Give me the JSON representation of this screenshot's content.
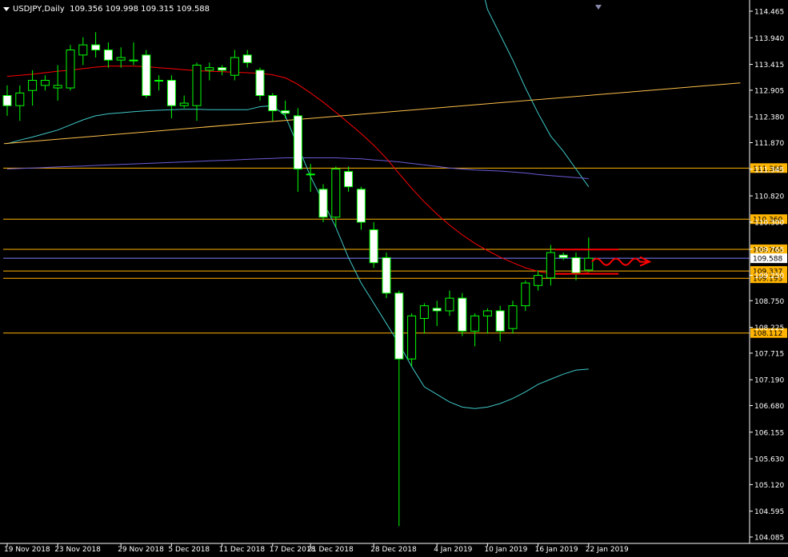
{
  "header": {
    "symbol": "USDJPY,Daily",
    "ohlc": "109.356 109.998 109.315 109.588"
  },
  "colors": {
    "background": "#000000",
    "up_candle": "#000000",
    "down_candle": "#ffffff",
    "wick": "#00ff00",
    "axis": "#ffffff",
    "hline": "#ffb400",
    "ma_red": "#ff0000",
    "ma_purple": "#6b5bd6",
    "bollinger": "#40c8c8",
    "trendline": "#ffc04a",
    "price_line": "#7f7fff",
    "annotation": "#ff0000"
  },
  "chart_data": {
    "type": "candlestick",
    "ylim": [
      104.085,
      114.465
    ],
    "y_ticks": [
      "114.465",
      "113.940",
      "113.415",
      "112.905",
      "112.380",
      "111.870",
      "111.345",
      "110.820",
      "110.300",
      "109.765",
      "109.250",
      "108.750",
      "108.225",
      "107.715",
      "107.190",
      "106.680",
      "106.155",
      "105.630",
      "105.120",
      "104.595",
      "104.085"
    ],
    "x_labels": [
      "19 Nov 2018",
      "23 Nov 2018",
      "29 Nov 2018",
      "5 Dec 2018",
      "11 Dec 2018",
      "17 Dec 2018",
      "21 Dec 2018",
      "28 Dec 2018",
      "4 Jan 2019",
      "10 Jan 2019",
      "16 Jan 2019",
      "22 Jan 2019"
    ],
    "x_label_index": [
      0,
      4,
      9,
      13,
      17,
      21,
      24,
      29,
      34,
      38,
      42,
      46
    ],
    "candles": [
      {
        "o": 112.8,
        "h": 113.0,
        "l": 112.4,
        "c": 112.6
      },
      {
        "o": 112.6,
        "h": 113.0,
        "l": 112.3,
        "c": 112.85
      },
      {
        "o": 112.9,
        "h": 113.3,
        "l": 112.6,
        "c": 113.1
      },
      {
        "o": 113.0,
        "h": 113.2,
        "l": 112.9,
        "c": 113.1
      },
      {
        "o": 112.95,
        "h": 113.4,
        "l": 112.7,
        "c": 113.0
      },
      {
        "o": 112.95,
        "h": 113.8,
        "l": 112.9,
        "c": 113.7
      },
      {
        "o": 113.6,
        "h": 113.95,
        "l": 113.4,
        "c": 113.8
      },
      {
        "o": 113.8,
        "h": 114.05,
        "l": 113.55,
        "c": 113.7
      },
      {
        "o": 113.7,
        "h": 113.85,
        "l": 113.35,
        "c": 113.5
      },
      {
        "o": 113.5,
        "h": 113.75,
        "l": 113.35,
        "c": 113.55
      },
      {
        "o": 113.5,
        "h": 113.85,
        "l": 113.4,
        "c": 113.5
      },
      {
        "o": 113.6,
        "h": 113.7,
        "l": 112.75,
        "c": 112.8
      },
      {
        "o": 113.1,
        "h": 113.2,
        "l": 112.9,
        "c": 113.1
      },
      {
        "o": 113.1,
        "h": 113.2,
        "l": 112.35,
        "c": 112.6
      },
      {
        "o": 112.6,
        "h": 112.8,
        "l": 112.55,
        "c": 112.65
      },
      {
        "o": 112.6,
        "h": 113.45,
        "l": 112.3,
        "c": 113.4
      },
      {
        "o": 113.3,
        "h": 113.45,
        "l": 113.1,
        "c": 113.35
      },
      {
        "o": 113.35,
        "h": 113.4,
        "l": 113.2,
        "c": 113.3
      },
      {
        "o": 113.2,
        "h": 113.7,
        "l": 113.1,
        "c": 113.55
      },
      {
        "o": 113.6,
        "h": 113.7,
        "l": 113.35,
        "c": 113.45
      },
      {
        "o": 113.3,
        "h": 113.35,
        "l": 112.7,
        "c": 112.8
      },
      {
        "o": 112.8,
        "h": 112.85,
        "l": 112.3,
        "c": 112.5
      },
      {
        "o": 112.5,
        "h": 112.7,
        "l": 112.35,
        "c": 112.45
      },
      {
        "o": 112.4,
        "h": 112.55,
        "l": 110.9,
        "c": 111.35
      },
      {
        "o": 111.25,
        "h": 111.45,
        "l": 110.9,
        "c": 111.25
      },
      {
        "o": 110.95,
        "h": 111.05,
        "l": 110.3,
        "c": 110.4
      },
      {
        "o": 110.4,
        "h": 111.4,
        "l": 110.2,
        "c": 111.35
      },
      {
        "o": 111.3,
        "h": 111.4,
        "l": 110.9,
        "c": 111.0
      },
      {
        "o": 110.95,
        "h": 111.0,
        "l": 110.15,
        "c": 110.3
      },
      {
        "o": 110.15,
        "h": 110.3,
        "l": 109.4,
        "c": 109.5
      },
      {
        "o": 109.6,
        "h": 109.7,
        "l": 108.8,
        "c": 108.9
      },
      {
        "o": 108.9,
        "h": 108.95,
        "l": 104.3,
        "c": 107.6
      },
      {
        "o": 107.6,
        "h": 108.5,
        "l": 107.45,
        "c": 108.45
      },
      {
        "o": 108.4,
        "h": 108.7,
        "l": 108.1,
        "c": 108.65
      },
      {
        "o": 108.6,
        "h": 108.75,
        "l": 108.25,
        "c": 108.55
      },
      {
        "o": 108.55,
        "h": 108.95,
        "l": 108.45,
        "c": 108.8
      },
      {
        "o": 108.8,
        "h": 108.9,
        "l": 108.05,
        "c": 108.15
      },
      {
        "o": 108.15,
        "h": 108.5,
        "l": 107.85,
        "c": 108.45
      },
      {
        "o": 108.45,
        "h": 108.6,
        "l": 108.1,
        "c": 108.55
      },
      {
        "o": 108.55,
        "h": 108.65,
        "l": 107.95,
        "c": 108.15
      },
      {
        "o": 108.2,
        "h": 108.75,
        "l": 108.1,
        "c": 108.65
      },
      {
        "o": 108.65,
        "h": 109.15,
        "l": 108.55,
        "c": 109.1
      },
      {
        "o": 109.05,
        "h": 109.35,
        "l": 108.95,
        "c": 109.25
      },
      {
        "o": 109.2,
        "h": 109.85,
        "l": 109.05,
        "c": 109.7
      },
      {
        "o": 109.65,
        "h": 109.7,
        "l": 109.55,
        "c": 109.6
      },
      {
        "o": 109.6,
        "h": 109.7,
        "l": 109.15,
        "c": 109.3
      },
      {
        "o": 109.356,
        "h": 109.998,
        "l": 109.315,
        "c": 109.588
      }
    ],
    "ma_red": [
      113.18,
      113.2,
      113.22,
      113.25,
      113.28,
      113.3,
      113.33,
      113.36,
      113.38,
      113.38,
      113.38,
      113.37,
      113.35,
      113.33,
      113.31,
      113.29,
      113.28,
      113.27,
      113.26,
      113.25,
      113.24,
      113.21,
      113.15,
      113.02,
      112.85,
      112.67,
      112.47,
      112.26,
      112.05,
      111.82,
      111.56,
      111.26,
      110.97,
      110.7,
      110.46,
      110.24,
      110.05,
      109.88,
      109.74,
      109.61,
      109.5,
      109.4,
      109.33,
      109.28,
      109.27,
      109.28,
      109.3
    ],
    "ma_purple": [
      111.35,
      111.36,
      111.37,
      111.38,
      111.39,
      111.4,
      111.41,
      111.42,
      111.43,
      111.44,
      111.45,
      111.46,
      111.47,
      111.48,
      111.49,
      111.5,
      111.51,
      111.52,
      111.53,
      111.54,
      111.55,
      111.56,
      111.57,
      111.57,
      111.57,
      111.57,
      111.57,
      111.56,
      111.55,
      111.53,
      111.51,
      111.49,
      111.46,
      111.43,
      111.4,
      111.37,
      111.35,
      111.33,
      111.32,
      111.31,
      111.29,
      111.27,
      111.24,
      111.22,
      111.2,
      111.18,
      111.16
    ],
    "bb_upper": [
      114.7,
      114.75,
      114.8,
      114.85,
      114.88,
      114.9,
      114.92,
      114.94,
      114.95,
      114.96,
      114.96,
      114.96,
      114.95,
      114.94,
      114.93,
      114.92,
      114.92,
      114.92,
      114.92,
      114.92,
      114.92,
      114.95,
      115.05,
      115.15,
      115.25,
      115.3,
      115.35,
      115.38,
      115.4,
      115.42,
      115.44,
      115.46,
      115.48,
      115.5,
      115.52,
      115.52,
      115.51,
      115.49,
      114.5,
      114.0,
      113.5,
      112.95,
      112.45,
      112.0,
      111.7,
      111.35,
      111.0
    ],
    "bb_lower": [
      111.85,
      111.92,
      111.98,
      112.05,
      112.12,
      112.22,
      112.32,
      112.4,
      112.44,
      112.46,
      112.48,
      112.5,
      112.51,
      112.52,
      112.53,
      112.53,
      112.52,
      112.52,
      112.52,
      112.52,
      112.58,
      112.6,
      112.4,
      111.8,
      111.2,
      110.7,
      110.2,
      109.6,
      109.1,
      108.7,
      108.3,
      107.9,
      107.45,
      107.05,
      106.9,
      106.75,
      106.65,
      106.62,
      106.65,
      106.72,
      106.82,
      106.95,
      107.1,
      107.2,
      107.3,
      107.38,
      107.4
    ],
    "bb_lower_start": 0,
    "trendline": {
      "from_index": 0,
      "from_value": 111.85,
      "to_index": 58.0,
      "to_value": 113.05
    },
    "price_line": 109.588,
    "levels": [
      {
        "value": 111.368,
        "label": "111.368"
      },
      {
        "value": 110.36,
        "label": "110.360"
      },
      {
        "value": 109.765,
        "label": "109.765"
      },
      {
        "value": 109.337,
        "label": "109.337"
      },
      {
        "value": 109.193,
        "label": "109.193"
      },
      {
        "value": 108.112,
        "label": "108.112"
      }
    ],
    "current_price_label": "109.588",
    "range_lines": [
      {
        "value": 109.76,
        "from_index": 44,
        "to_index": 49
      },
      {
        "value": 109.28,
        "from_index": 44,
        "to_index": 49
      }
    ]
  }
}
